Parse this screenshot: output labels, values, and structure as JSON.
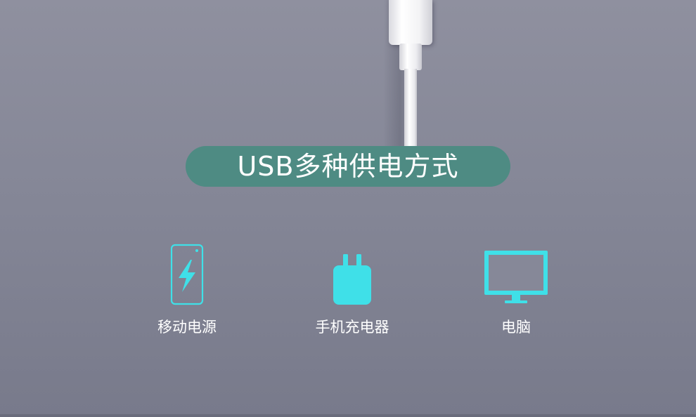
{
  "title": "USB多种供电方式",
  "items": [
    {
      "label": "移动电源",
      "icon": "power-bank-icon"
    },
    {
      "label": "手机充电器",
      "icon": "phone-charger-icon"
    },
    {
      "label": "电脑",
      "icon": "computer-monitor-icon"
    }
  ],
  "colors": {
    "background": "#868898",
    "pill": "#4e8b83",
    "icon_accent": "#3fe0e8",
    "text": "#ffffff"
  }
}
